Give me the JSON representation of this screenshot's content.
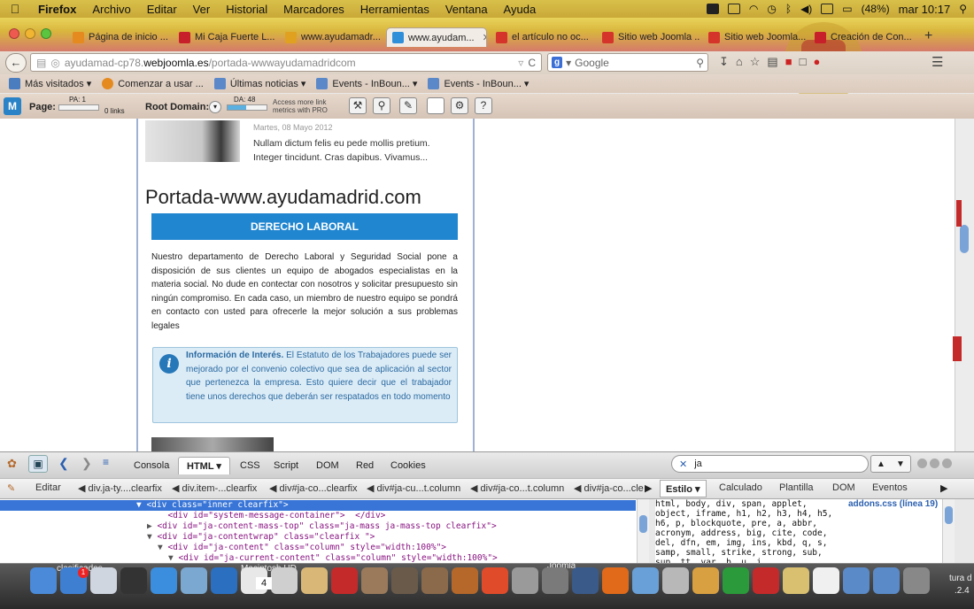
{
  "menubar": {
    "app": "Firefox",
    "items": [
      "Archivo",
      "Editar",
      "Ver",
      "Historial",
      "Marcadores",
      "Herramientas",
      "Ventana",
      "Ayuda"
    ],
    "battery": "(48%)",
    "clock": "mar 10:17"
  },
  "tabs": [
    {
      "label": "Página de inicio ...",
      "color": "#e58a1f"
    },
    {
      "label": "Mi Caja Fuerte L...",
      "color": "#c8202a"
    },
    {
      "label": "www.ayudamadr...",
      "color": "#e0a020"
    },
    {
      "label": "www.ayudam...",
      "color": "#2f8fd8",
      "active": true
    },
    {
      "label": "el artículo no oc...",
      "color": "#d4342a"
    },
    {
      "label": "Sitio web Joomla ...",
      "color": "#d4342a"
    },
    {
      "label": "Sitio web Joomla...",
      "color": "#d4342a"
    },
    {
      "label": "Creación de Con...",
      "color": "#c8202a"
    }
  ],
  "navbar": {
    "url_prefix": "ayudamad-cp78.",
    "url_domain": "webjoomla.es",
    "url_suffix": "/portada-wwwayudamadridcom",
    "search_placeholder": "Google",
    "search_badge": "g"
  },
  "bookmarks": [
    {
      "label": "Más visitados ▾"
    },
    {
      "label": "Comenzar a usar ..."
    },
    {
      "label": "Últimas noticias ▾"
    },
    {
      "label": "Events - InBoun... ▾"
    },
    {
      "label": "Events - InBoun... ▾"
    }
  ],
  "mozbar": {
    "logo": "M",
    "page_label": "Page:",
    "pa": "PA: 1",
    "links": "0 links",
    "root_label": "Root Domain:",
    "da": "DA: 48",
    "access": "Access more link",
    "access2": "metrics with PRO"
  },
  "page": {
    "date": "Martes, 08 Mayo 2012",
    "excerpt": "Nullam dictum felis eu pede mollis pretium. Integer tincidunt. Cras dapibus. Vivamus...",
    "title": "Portada-www.ayudamadrid.com",
    "banner": "DERECHO LABORAL",
    "body": "Nuestro departamento de Derecho Laboral y Seguridad Social pone a disposición de sus clientes un equipo de abogados especialistas en la materia social. No dude en contectar con nosotros y solicitar presupuesto sin ningún compromiso. En cada caso, un miembro de nuestro equipo se pondrá en contacto con usted para ofrecerle la mejor solución a sus problemas legales",
    "info_bold": "Información de Interés.",
    "info_text": " El Estatuto de los Trabajadores puede ser mejorado por el convenio colectivo que sea de aplicación al sector que pertenezca la empresa. Esto quiere decir que el trabajador tiene unos derechos que deberán ser respatados en todo momento"
  },
  "devtools": {
    "tabs": [
      "Consola",
      "HTML ▾",
      "CSS",
      "Script",
      "DOM",
      "Red",
      "Cookies"
    ],
    "search_value": "ja",
    "edit": "Editar",
    "crumbs": [
      "div.ja-ty....clearfix",
      "div.item-...clearfix",
      "div#ja-co...clearfix",
      "div#ja-cu...t.column",
      "div#ja-co...t.column",
      "div#ja-co...cle"
    ],
    "right_tabs": [
      "Estilo ▾",
      "Calculado",
      "Plantilla",
      "DOM",
      "Eventos"
    ],
    "css_source": "addons.css (línea 19)",
    "css_selectors": "html, body, div, span, applet, object, iframe, h1, h2, h3, h4, h5, h6, p, blockquote, pre, a, abbr, acronym, address, big, cite, code, del, dfn, em, img, ins, kbd, q, s, samp, small, strike, strong, sub, sup, tt, var, b, u, i,",
    "html_lines": [
      {
        "indent": 0,
        "arrow": "▼",
        "text": "<div class=\"inner clearfix\">",
        "selected": true
      },
      {
        "indent": 2,
        "arrow": "",
        "text": "<div id=\"system-message-container\">  </div>"
      },
      {
        "indent": 1,
        "arrow": "▶",
        "text": "<div id=\"ja-content-mass-top\" class=\"ja-mass ja-mass-top clearfix\">"
      },
      {
        "indent": 1,
        "arrow": "▼",
        "text": "<div id=\"ja-contentwrap\" class=\"clearfix \">"
      },
      {
        "indent": 2,
        "arrow": "▼",
        "text": "<div id=\"ja-content\" class=\"column\" style=\"width:100%\">"
      },
      {
        "indent": 3,
        "arrow": "▼",
        "text": "<div id=\"ja-current-content\" class=\"column\" style=\"width:100%\">"
      }
    ]
  },
  "dock": {
    "label_left": "clasificados",
    "label_mid": "Macintosh HD",
    "label_joomla": "Joomla",
    "label_right": "tura d",
    "label_right2": ".2.4",
    "calendar_day": "4",
    "mail_badge": "1"
  }
}
